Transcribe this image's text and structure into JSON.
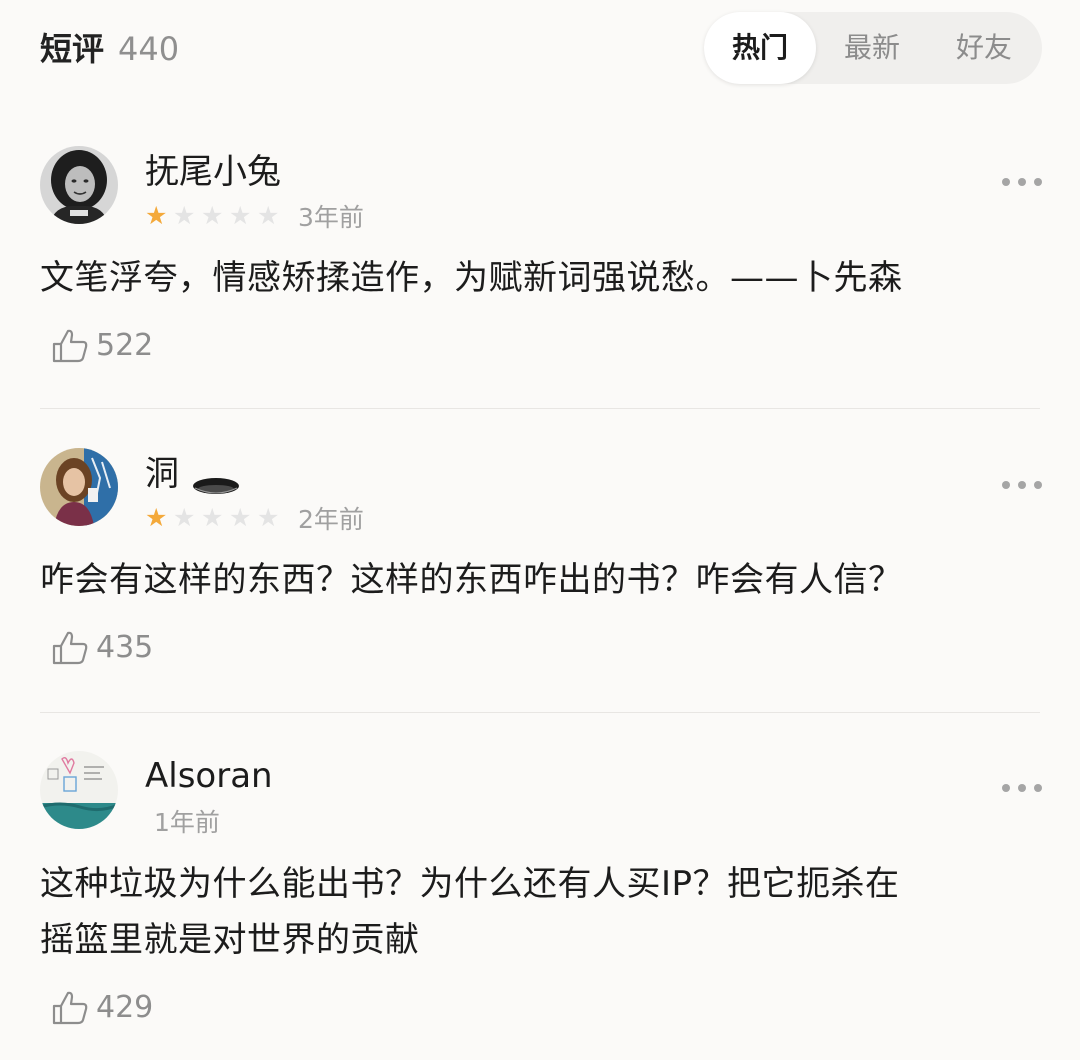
{
  "header": {
    "title": "短评",
    "count": "440",
    "tabs": [
      {
        "label": "热门",
        "active": true
      },
      {
        "label": "最新",
        "active": false
      },
      {
        "label": "好友",
        "active": false
      }
    ]
  },
  "comments": [
    {
      "username": "抚尾小兔",
      "rating": 1,
      "max_rating": 5,
      "time": "3年前",
      "text": "文笔浮夸，情感矫揉造作，为赋新词强说愁。——卜先森",
      "likes": "522",
      "avatar_icon": "avatar-photo-woman-dark-hair"
    },
    {
      "username": "洞",
      "name_icon": "hole-icon",
      "rating": 1,
      "max_rating": 5,
      "time": "2年前",
      "text": "咋会有这样的东西？这样的东西咋出的书？咋会有人信？",
      "likes": "435",
      "avatar_icon": "avatar-photo-woman-blue-background"
    },
    {
      "username": "Alsoran",
      "time": "1年前",
      "text_line1": "这种垃圾为什么能出书？为什么还有人买IP？把它扼杀在",
      "text_line2": "摇篮里就是对世界的贡献",
      "likes": "429",
      "avatar_icon": "avatar-drawing-sketch"
    }
  ],
  "colors": {
    "background": "#fbfaf8",
    "star_filled": "#f4a93a",
    "star_empty": "#e4e4e4",
    "muted_text": "#a0a0a0"
  }
}
